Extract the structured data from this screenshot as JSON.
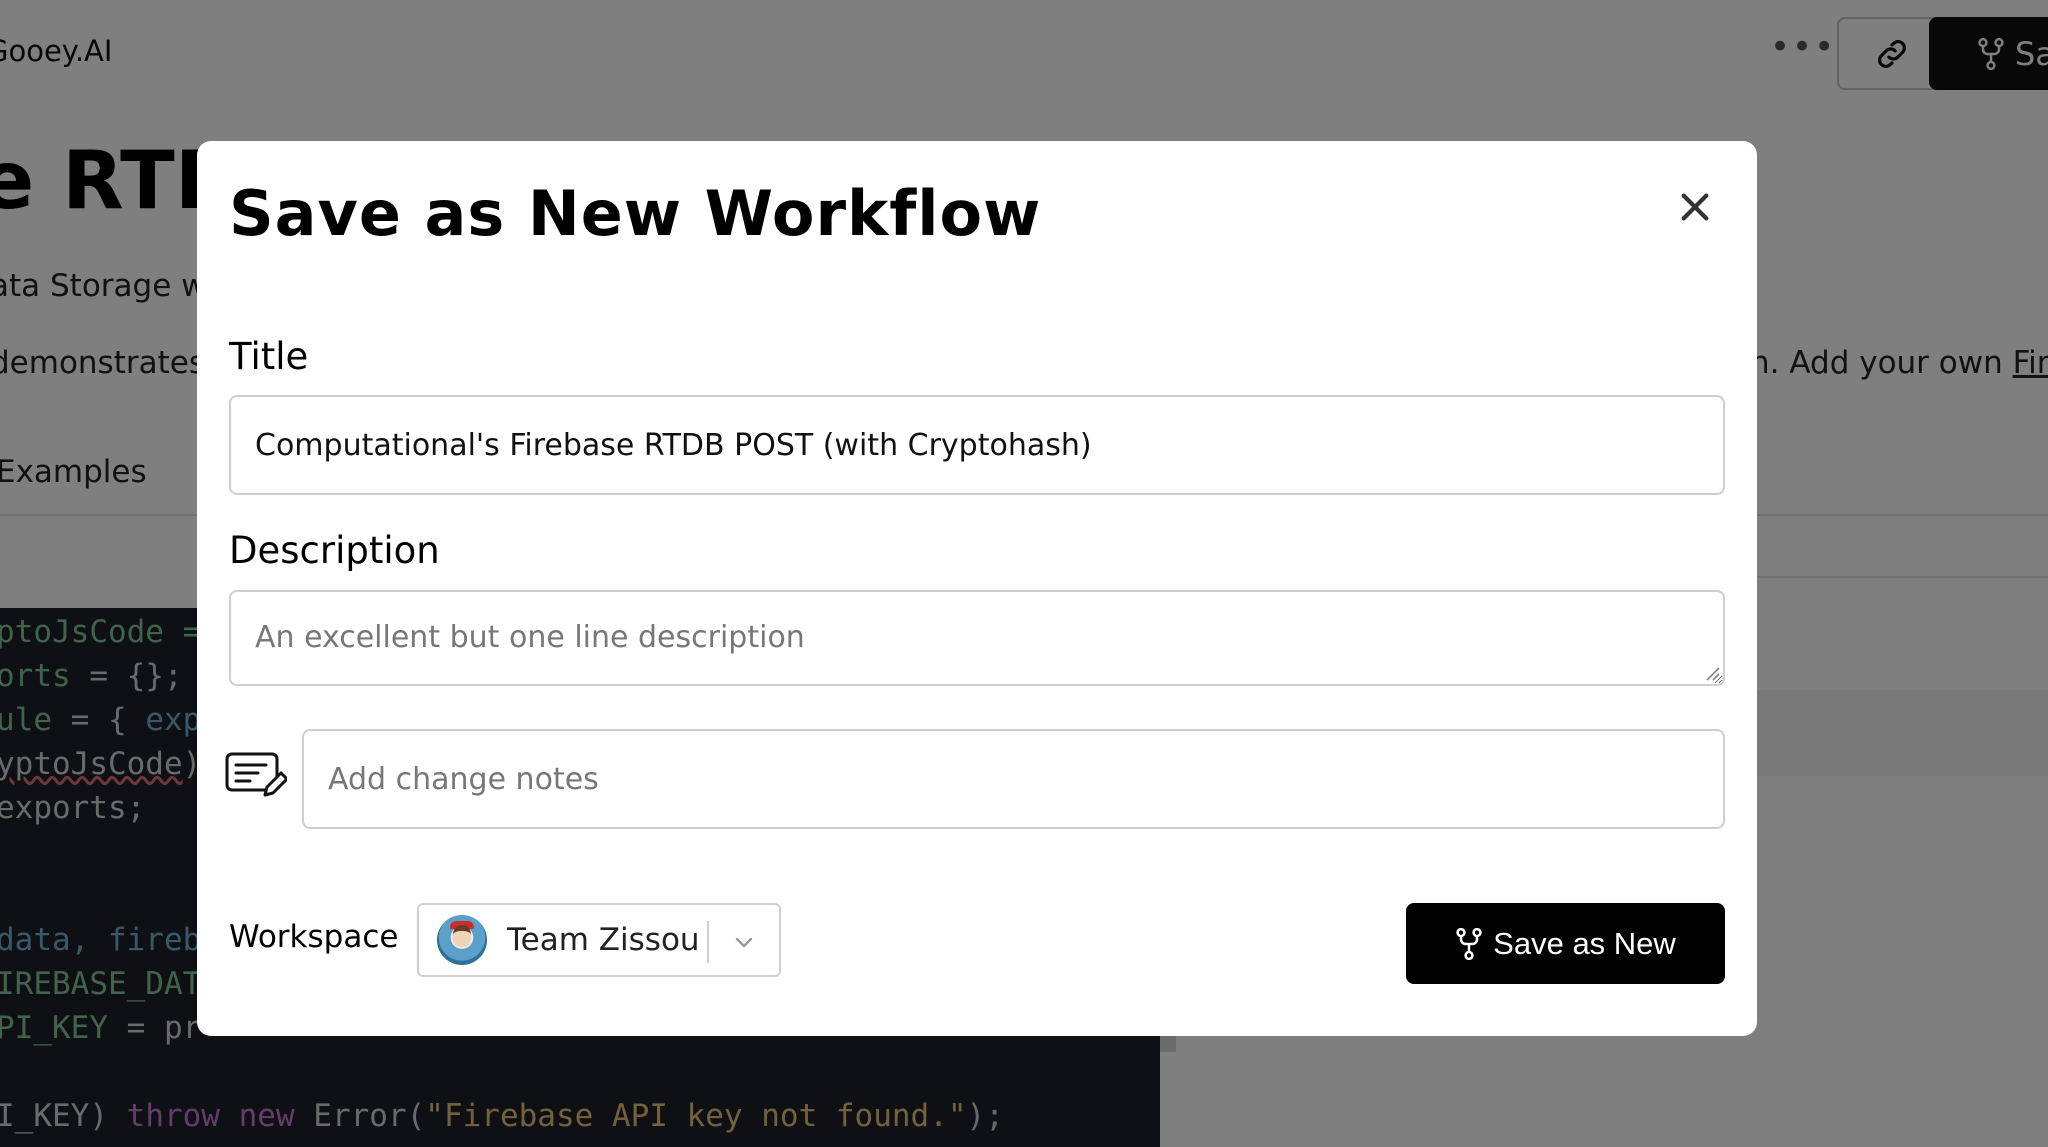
{
  "background": {
    "brand": "Gooey.AI",
    "more_label": "•••",
    "save_label": "Sa",
    "page_title": "e RTDB",
    "subtitle": "ata Storage wi",
    "body_left": "demonstrates",
    "body_right_prefix": "n. Add your own ",
    "body_right_link": "Fire",
    "tab_examples": "Examples",
    "code": {
      "l1": "ptoJsCode =",
      "l2a": "orts",
      "l2b": " = {};",
      "l3a": "ule",
      "l3b": " = { ",
      "l3c": "exp",
      "l4": "yptoJsCode",
      "l4b": ")",
      "l5": "exports;",
      "l6a": "data, ",
      "l6b": "fireb",
      "l7": "IREBASE_DAT",
      "l8a": "PI_KEY",
      "l8b": " = ",
      "l8c": "pr",
      "l9a": "I_KEY) ",
      "l9b": "throw new",
      "l9c": " Error(",
      "l9d": "\"Firebase API key not found.\"",
      "l9e": ");"
    }
  },
  "modal": {
    "title": "Save as New Workflow",
    "title_label": "Title",
    "title_value": "Computational's Firebase RTDB POST (with Cryptohash)",
    "description_label": "Description",
    "description_placeholder": "An excellent but one line description",
    "notes_placeholder": "Add change notes",
    "workspace_label": "Workspace",
    "workspace_name": "Team Zissou",
    "save_button_label": "Save as New"
  },
  "icons": {
    "close": "close-icon",
    "notes": "edit-notes-icon",
    "fork": "fork-icon",
    "link": "link-icon",
    "chevron": "chevron-down-icon"
  },
  "colors": {
    "primary_button": "#000000",
    "overlay": "rgba(0,0,0,0.5)",
    "border": "#cfcfcf"
  }
}
